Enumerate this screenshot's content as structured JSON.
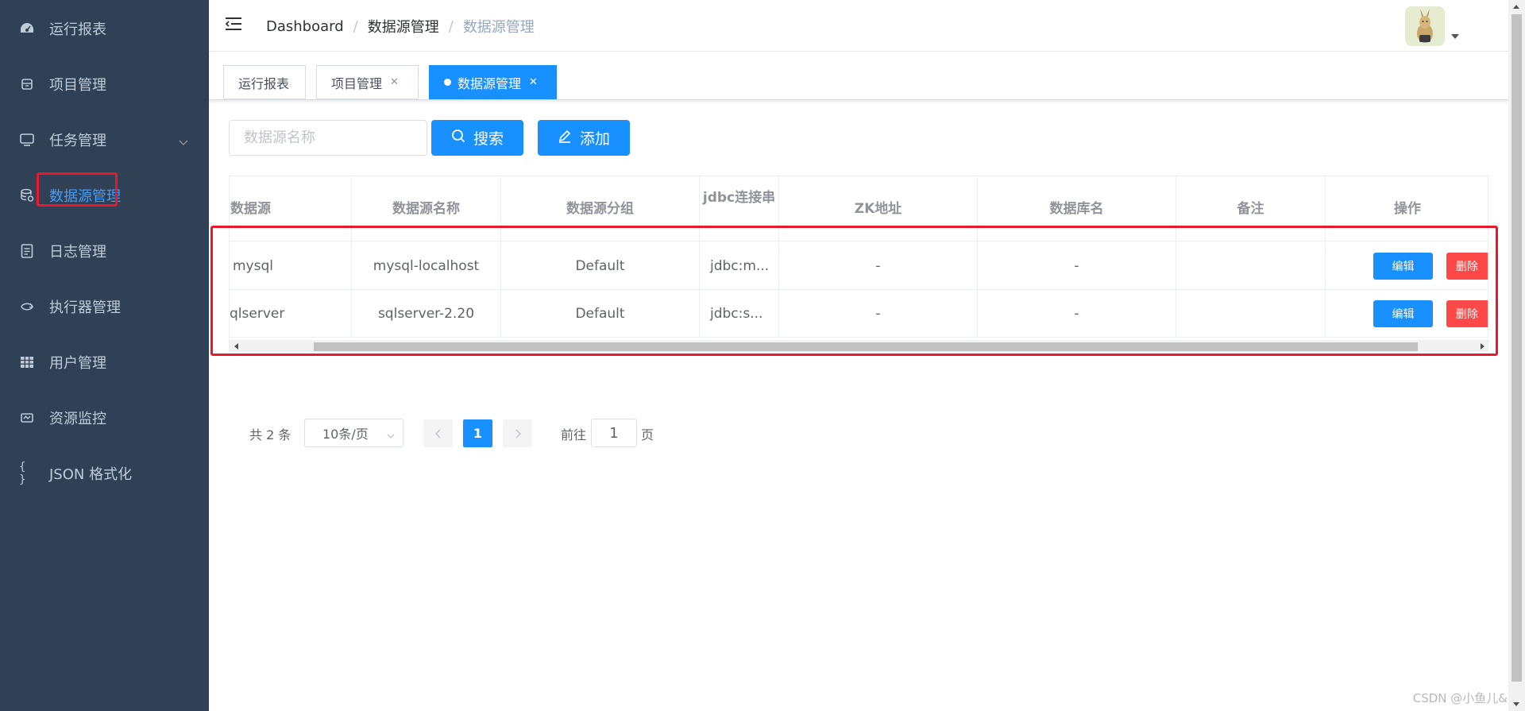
{
  "sidebar": {
    "items": [
      {
        "label": "运行报表",
        "icon": "dashboard-icon"
      },
      {
        "label": "项目管理",
        "icon": "project-icon"
      },
      {
        "label": "任务管理",
        "icon": "monitor-icon"
      },
      {
        "label": "数据源管理",
        "icon": "database-icon"
      },
      {
        "label": "日志管理",
        "icon": "log-icon"
      },
      {
        "label": "执行器管理",
        "icon": "executor-icon"
      },
      {
        "label": "用户管理",
        "icon": "table-grid-icon"
      },
      {
        "label": "资源监控",
        "icon": "resource-icon"
      },
      {
        "label": "JSON 格式化",
        "icon": "braces-icon"
      }
    ],
    "active_label": "数据源管理"
  },
  "header": {
    "breadcrumb": [
      "Dashboard",
      "数据源管理",
      "数据源管理"
    ]
  },
  "tags": [
    {
      "label": "运行报表"
    },
    {
      "label": "项目管理"
    },
    {
      "label": "数据源管理"
    }
  ],
  "filter": {
    "search_placeholder": "数据源名称",
    "search_label": "搜索",
    "add_label": "添加"
  },
  "table": {
    "columns": [
      "数据源",
      "数据源名称",
      "数据源分组",
      "jdbc连接串",
      "ZK地址",
      "数据库名",
      "备注",
      "操作"
    ],
    "rows": [
      {
        "datasource": "mysql",
        "name": "mysql-localhost",
        "group": "Default",
        "jdbc": "jdbc:m...",
        "zk": "-",
        "db": "-",
        "remark": ""
      },
      {
        "datasource": "qlserver",
        "name": "sqlserver-2.20",
        "group": "Default",
        "jdbc": "jdbc:s...",
        "zk": "-",
        "db": "-",
        "remark": ""
      }
    ],
    "edit_label": "编辑",
    "delete_label": "删除"
  },
  "pagination": {
    "total_text": "共 2 条",
    "page_size": "10条/页",
    "current_page": "1",
    "goto_label": "前往",
    "goto_value": "1",
    "page_suffix": "页"
  },
  "watermark": "CSDN @小鱼儿&",
  "colors": {
    "sidebar_bg": "#304156",
    "primary": "#1890ff",
    "danger": "#ff4949",
    "highlight": "#e8192c"
  }
}
